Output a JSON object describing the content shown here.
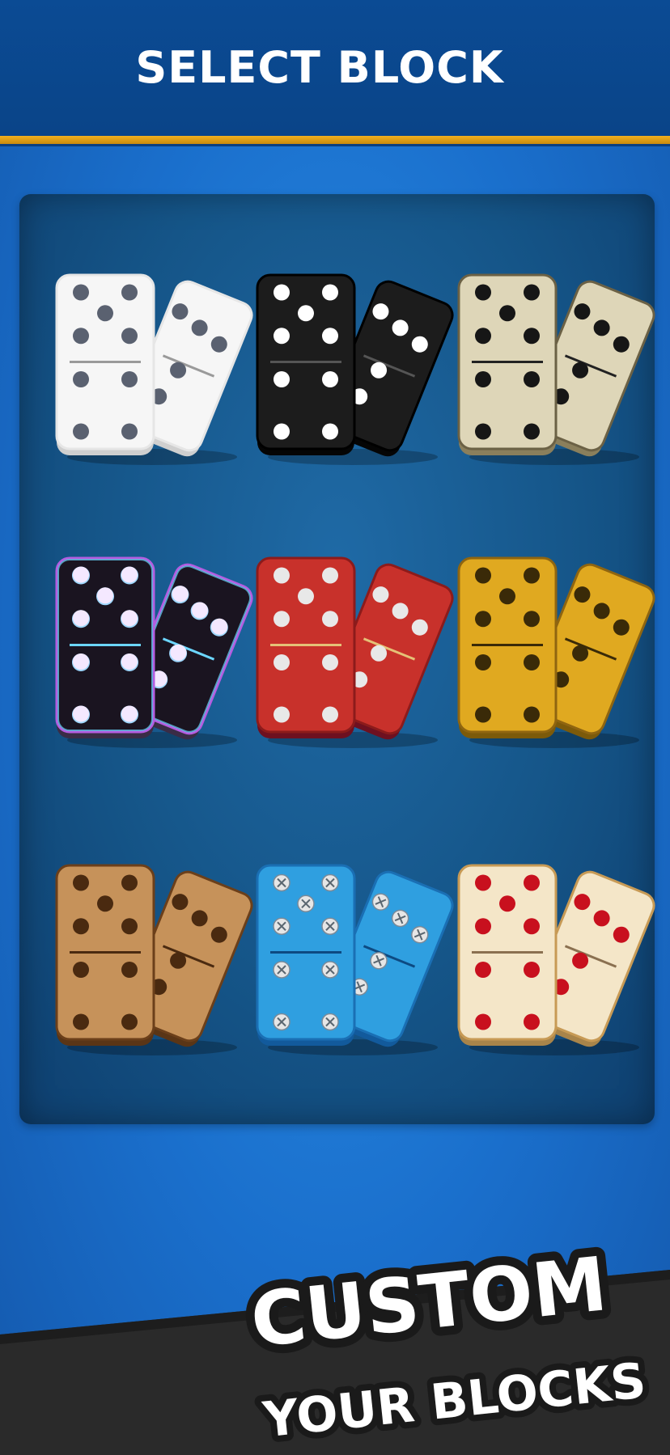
{
  "header": {
    "title": "SELECT BLOCK"
  },
  "banner": {
    "line1": "CUSTOM",
    "line2": "YOUR BLOCKS"
  },
  "skins": [
    {
      "id": "classic-white",
      "face": "#f6f6f6",
      "edge": "#cfcfcf",
      "pip": "#5a6170",
      "line": "#9a9a9a",
      "outline": "#e6e6e6"
    },
    {
      "id": "black",
      "face": "#1c1c1c",
      "edge": "#050505",
      "pip": "#ffffff",
      "line": "#555555",
      "outline": "#000000"
    },
    {
      "id": "ivory",
      "face": "#ded6b8",
      "edge": "#8a7f5c",
      "pip": "#161616",
      "line": "#222222",
      "outline": "#6b6145"
    },
    {
      "id": "neon",
      "face": "#1a1420",
      "edge": "#3a2c46",
      "pip": "#f4e8ff",
      "line": "#6cd6ff",
      "outline": "#b45de0"
    },
    {
      "id": "red",
      "face": "#c8312b",
      "edge": "#6e1020",
      "pip": "#e8e8e8",
      "line": "#e5c177",
      "outline": "#8c1b1b"
    },
    {
      "id": "gold",
      "face": "#e0a920",
      "edge": "#7c5a0a",
      "pip": "#3a2a08",
      "line": "#3a2a08",
      "outline": "#8f6510"
    },
    {
      "id": "wood",
      "face": "#c6925a",
      "edge": "#5a3516",
      "pip": "#4a2a10",
      "line": "#4a2a10",
      "outline": "#6b3f1a"
    },
    {
      "id": "blue-screws",
      "face": "#2f9fe0",
      "edge": "#125a9c",
      "pip": "#d9d9d9",
      "line": "#0d4a82",
      "outline": "#1a6fb4"
    },
    {
      "id": "cream-red",
      "face": "#f4e6c8",
      "edge": "#a8844a",
      "pip": "#c8101e",
      "line": "#8a7050",
      "outline": "#c79a55"
    }
  ]
}
